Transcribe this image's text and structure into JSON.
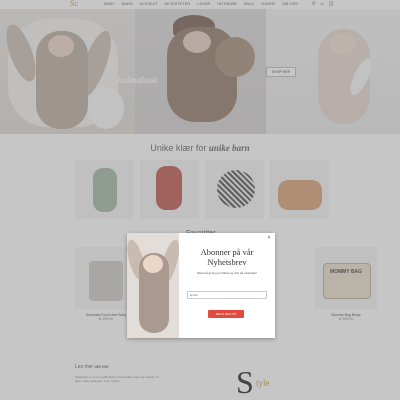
{
  "nav": {
    "logo": "Sc",
    "items": [
      "BABY",
      "BARN",
      "KLESKAT",
      "AKTIVITETER",
      "LEKER",
      "INTERIØR",
      "SALG",
      "GAVER",
      "OM OSS"
    ],
    "icons": [
      "search-icon",
      "user-icon",
      "cart-icon"
    ]
  },
  "hero": {
    "panel2_label": "Animalsuit",
    "panel3_button": "SHOP HER"
  },
  "section_unike": {
    "prefix": "Unike klær for",
    "emphasis": "unike barn"
  },
  "favorites": {
    "heading": "Favoritter"
  },
  "products": [
    {
      "name": "Dekorativ Kurv/Leke Baby",
      "price": "kr 299,00"
    },
    {
      "name": "Mommy Bag Beige",
      "price": "kr 699,00",
      "image_text": "MOMMY BAG"
    }
  ],
  "about": {
    "heading_prefix": "Les mer",
    "heading_emphasis": "om oss",
    "text": "Stylebaby.no er en nettbutikk for barneklær, leker og interiør. Vi tilbyr unike produkter til de minste."
  },
  "brand": {
    "mark": "S",
    "word": "tyle"
  },
  "modal": {
    "title": "Abonner på vår Nyhetsbrev",
    "subtitle": "Meld på gi deg en tilbud og vær på nettsiden!",
    "email_placeholder": "Email",
    "button": "MELD DEG PÅ",
    "close": "×"
  },
  "colors": {
    "accent": "#e04a3f",
    "gold": "#b59a3a"
  }
}
